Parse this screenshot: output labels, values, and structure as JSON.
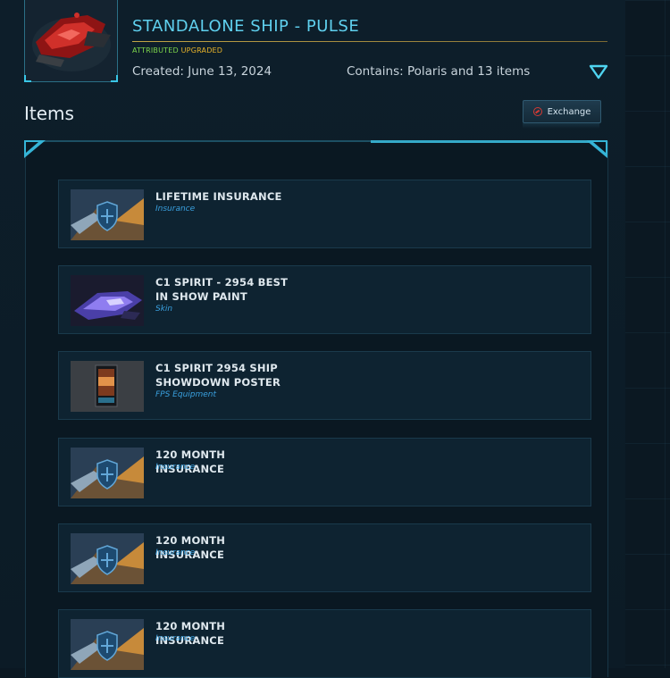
{
  "pledge": {
    "title": "STANDALONE SHIP - PULSE",
    "tag_attributed": "ATTRIBUTED",
    "tag_upgraded": "UPGRADED",
    "created": "Created: June 13, 2024",
    "contains": "Contains: Polaris and 13 items"
  },
  "items_section": {
    "heading": "Items",
    "exchange_label": "Exchange"
  },
  "items": [
    {
      "name": "LIFETIME INSURANCE",
      "type": "Insurance",
      "thumb": "insurance"
    },
    {
      "name": "C1 SPIRIT - 2954 BEST IN SHOW PAINT",
      "type": "Skin",
      "thumb": "skin"
    },
    {
      "name": "C1 SPIRIT 2954 SHIP SHOWDOWN POSTER",
      "type": "FPS Equipment",
      "thumb": "poster"
    },
    {
      "name": "120 MONTH INSURANCE",
      "type": "Insurance",
      "thumb": "insurance"
    },
    {
      "name": "120 MONTH INSURANCE",
      "type": "Insurance",
      "thumb": "insurance"
    },
    {
      "name": "120 MONTH INSURANCE",
      "type": "Insurance",
      "thumb": "insurance"
    }
  ],
  "colors": {
    "accent": "#5fd0ee",
    "attributed": "#7dd64b",
    "upgraded": "#e7b32a",
    "item_type": "#3aa1e0"
  },
  "icons": {
    "expand": "triangle-down-icon",
    "exchange": "exchange-forbidden-icon"
  }
}
